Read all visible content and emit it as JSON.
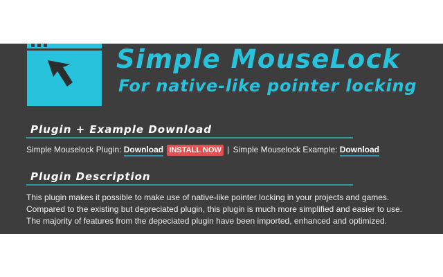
{
  "hero": {
    "title": "Simple MouseLock",
    "subtitle": "For native-like pointer locking"
  },
  "downloads": {
    "heading": "Plugin + Example Download",
    "plugin_label": "Simple Mouselock Plugin:",
    "plugin_link": "Download",
    "install_button": "INSTALL NOW",
    "separator": "|",
    "example_label": "Simple Mouselock Example:",
    "example_link": "Download"
  },
  "description": {
    "heading": "Plugin Description",
    "lines": [
      "This plugin makes it possible to make use of native-like pointer locking in your projects and games.",
      "Compared to the existing but depreciated plugin, this plugin is much more simplified and easier to use.",
      "The majority of features from the depeciated plugin have been imported, enhanced and optimized."
    ]
  },
  "colors": {
    "accent": "#27c3dc",
    "panel_background": "#3d3d3d",
    "install_button": "#e05252",
    "underline": "#3498a8"
  },
  "icons": {
    "logo": "window-cursor-icon"
  }
}
